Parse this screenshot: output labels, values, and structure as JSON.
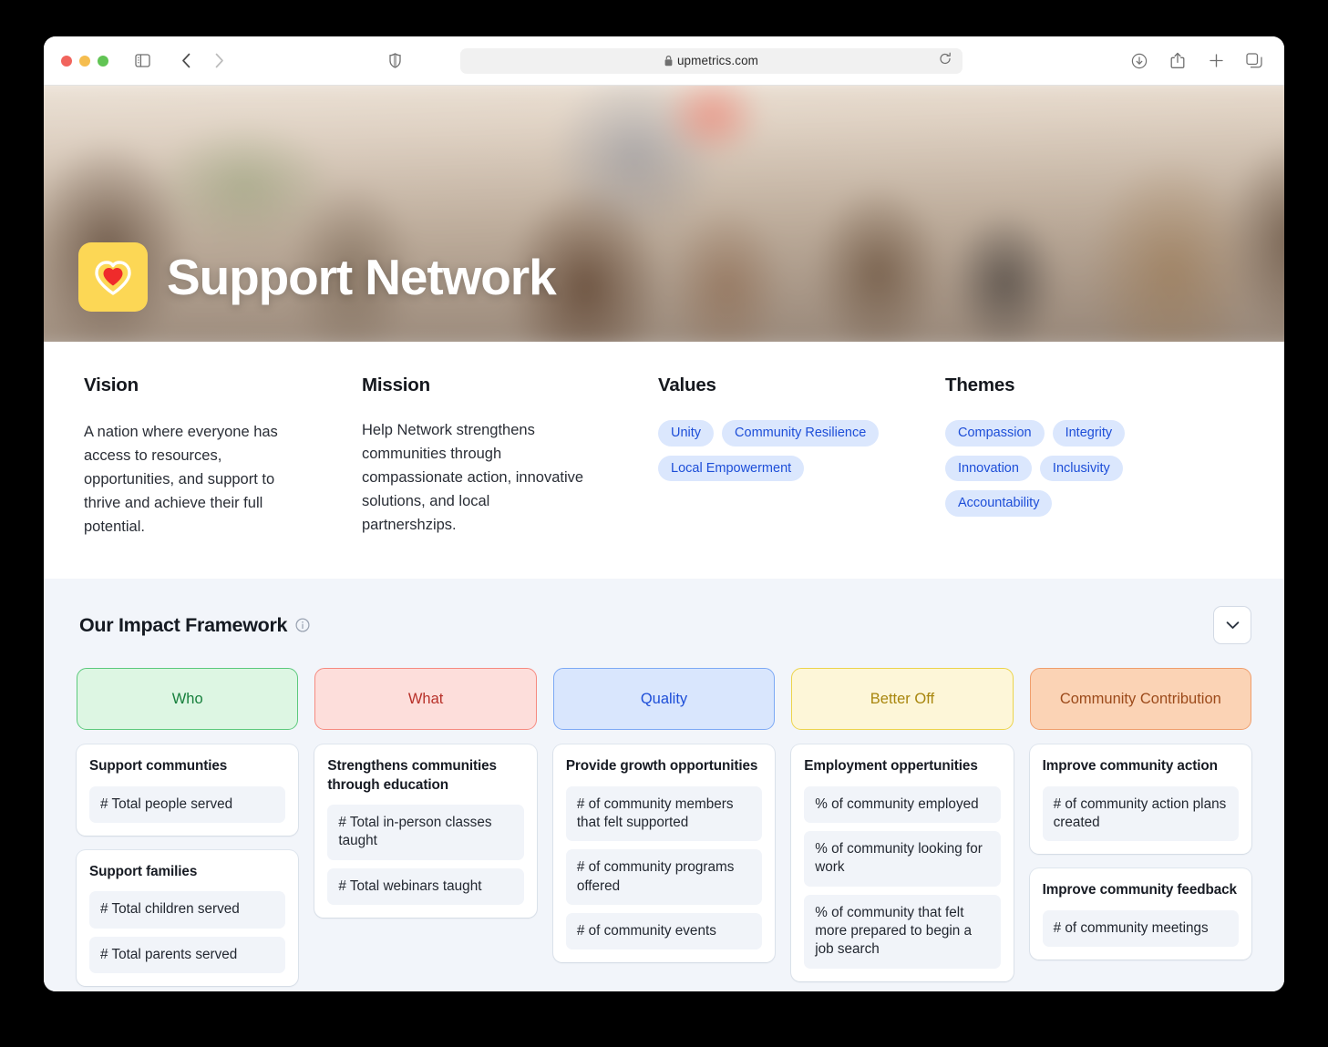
{
  "browser": {
    "url": "upmetrics.com",
    "lock_icon": "lock-icon",
    "icons": {
      "sidebar": "sidebar-toggle-icon",
      "back": "back-arrow-icon",
      "forward": "forward-arrow-icon",
      "shield": "privacy-shield-icon",
      "reload": "reload-icon",
      "downloads": "downloads-icon",
      "share": "share-icon",
      "new_tab": "plus-icon",
      "tab_overview": "tab-overview-icon"
    }
  },
  "hero": {
    "title": "Support Network",
    "logo": "heart-logo-icon",
    "logo_bg": "#fcd755",
    "heart_color": "#ef2b2b"
  },
  "info": {
    "vision": {
      "heading": "Vision",
      "body": "A nation where everyone has access to resources, opportunities, and support to thrive and achieve their full potential."
    },
    "mission": {
      "heading": "Mission",
      "body": "Help Network strengthens communities through compassionate action, innovative solutions, and local partnershzips."
    },
    "values": {
      "heading": "Values",
      "pills": [
        "Unity",
        "Community Resilience",
        "Local Empowerment"
      ]
    },
    "themes": {
      "heading": "Themes",
      "pills": [
        "Compassion",
        "Integrity",
        "Innovation",
        "Inclusivity",
        "Accountability"
      ]
    },
    "pill_bg": "#dbe7fd",
    "pill_text": "#1d4ed8"
  },
  "framework": {
    "title": "Our Impact Framework",
    "info_icon": "info-icon",
    "collapse_icon": "chevron-down-icon",
    "columns": [
      {
        "header": "Who",
        "bg": "#ddf6e3",
        "border": "#5cc97c",
        "text": "#17803d",
        "cards": [
          {
            "title": "Support communties",
            "metrics": [
              "# Total people served"
            ]
          },
          {
            "title": "Support families",
            "metrics": [
              "# Total children served",
              "# Total parents served"
            ]
          }
        ]
      },
      {
        "header": "What",
        "bg": "#fddedb",
        "border": "#f68a80",
        "text": "#b8312a",
        "cards": [
          {
            "title": "Strengthens communities through education",
            "metrics": [
              "# Total in-person classes taught",
              "# Total webinars taught"
            ]
          }
        ]
      },
      {
        "header": "Quality",
        "bg": "#d9e6fd",
        "border": "#7da9f5",
        "text": "#1d4ed8",
        "cards": [
          {
            "title": "Provide growth opportunities",
            "metrics": [
              "# of community members that felt supported",
              "# of community programs offered",
              "# of community events"
            ]
          }
        ]
      },
      {
        "header": "Better Off",
        "bg": "#fdf6d8",
        "border": "#ecd44b",
        "text": "#a8860d",
        "cards": [
          {
            "title": "Employment oppertunities",
            "metrics": [
              "% of community employed",
              "% of community looking for work",
              "% of community that felt more prepared to begin a job search"
            ]
          }
        ]
      },
      {
        "header": "Community Contribution",
        "bg": "#fbd3b5",
        "border": "#ef9e6c",
        "text": "#9c4a1a",
        "cards": [
          {
            "title": "Improve community action",
            "metrics": [
              "# of community action plans created"
            ]
          },
          {
            "title": "Improve community feedback",
            "metrics": [
              "# of community meetings"
            ]
          }
        ]
      }
    ]
  }
}
